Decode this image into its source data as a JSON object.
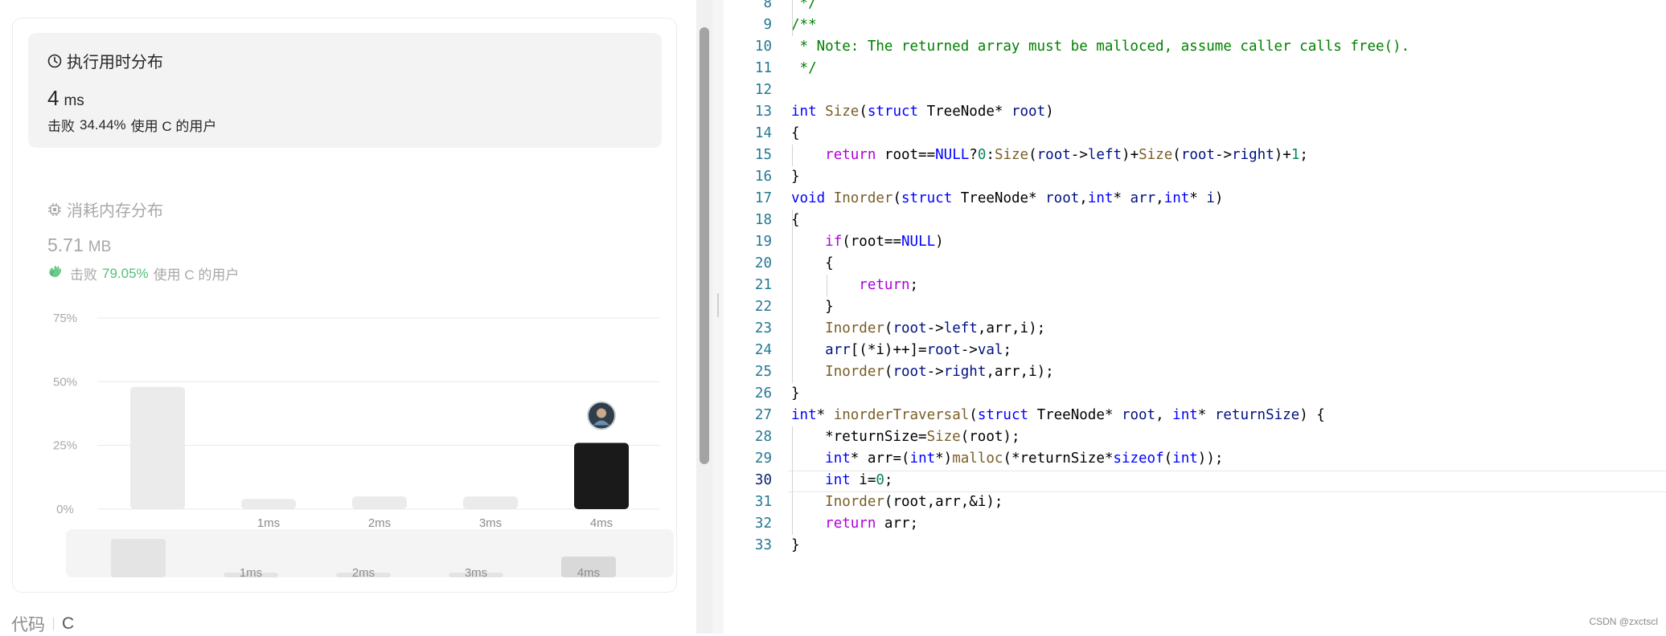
{
  "runtime": {
    "title": "执行用时分布",
    "value": "4",
    "unit": "ms",
    "beat_prefix": "击败",
    "beat_pct": "34.44%",
    "beat_suffix": "使用 C 的用户"
  },
  "memory": {
    "title": "消耗内存分布",
    "value": "5.71",
    "unit": "MB",
    "beat_prefix": "击败",
    "beat_pct": "79.05%",
    "beat_suffix": "使用 C 的用户"
  },
  "chart_data": {
    "type": "bar",
    "categories": [
      "",
      "1ms",
      "2ms",
      "3ms",
      "4ms"
    ],
    "values": [
      48,
      4,
      5,
      5,
      26
    ],
    "highlight_index": 4,
    "y_ticks": [
      "75%",
      "50%",
      "25%",
      "0%"
    ],
    "ylim": [
      0,
      75
    ],
    "grid": true,
    "colors": {
      "bar": "#ebebeb",
      "highlight": "#1a1a1a"
    }
  },
  "footer": {
    "code_label": "代码",
    "lang": "C"
  },
  "editor": {
    "current_line": 30,
    "lines": [
      {
        "n": "8",
        "tokens": [
          [
            "c",
            " */"
          ]
        ]
      },
      {
        "n": "9",
        "tokens": [
          [
            "c",
            "/**"
          ]
        ]
      },
      {
        "n": "10",
        "tokens": [
          [
            "c",
            " * Note: The returned array must be malloced, assume caller calls free()."
          ]
        ]
      },
      {
        "n": "11",
        "tokens": [
          [
            "c",
            " */"
          ]
        ]
      },
      {
        "n": "12",
        "tokens": []
      },
      {
        "n": "13",
        "tokens": [
          [
            "k",
            "int"
          ],
          [
            "p",
            " "
          ],
          [
            "f",
            "Size"
          ],
          [
            "p",
            "("
          ],
          [
            "k",
            "struct"
          ],
          [
            "p",
            " TreeNode* "
          ],
          [
            "v",
            "root"
          ],
          [
            "p",
            ")"
          ]
        ]
      },
      {
        "n": "14",
        "tokens": [
          [
            "p",
            "{"
          ]
        ]
      },
      {
        "n": "15",
        "tokens": [
          [
            "p",
            "    "
          ],
          [
            "ctl",
            "return"
          ],
          [
            "p",
            " root=="
          ],
          [
            "k",
            "NULL"
          ],
          [
            "p",
            "?"
          ],
          [
            "n",
            "0"
          ],
          [
            "p",
            ":"
          ],
          [
            "f",
            "Size"
          ],
          [
            "p",
            "("
          ],
          [
            "v",
            "root"
          ],
          [
            "p",
            "->"
          ],
          [
            "v",
            "left"
          ],
          [
            "p",
            ")+"
          ],
          [
            "f",
            "Size"
          ],
          [
            "p",
            "("
          ],
          [
            "v",
            "root"
          ],
          [
            "p",
            "->"
          ],
          [
            "v",
            "right"
          ],
          [
            "p",
            ")+"
          ],
          [
            "n",
            "1"
          ],
          [
            "p",
            ";"
          ]
        ]
      },
      {
        "n": "16",
        "tokens": [
          [
            "p",
            "}"
          ]
        ]
      },
      {
        "n": "17",
        "tokens": [
          [
            "k",
            "void"
          ],
          [
            "p",
            " "
          ],
          [
            "f",
            "Inorder"
          ],
          [
            "p",
            "("
          ],
          [
            "k",
            "struct"
          ],
          [
            "p",
            " TreeNode* "
          ],
          [
            "v",
            "root"
          ],
          [
            "p",
            ","
          ],
          [
            "k",
            "int"
          ],
          [
            "p",
            "* "
          ],
          [
            "v",
            "arr"
          ],
          [
            "p",
            ","
          ],
          [
            "k",
            "int"
          ],
          [
            "p",
            "* "
          ],
          [
            "v",
            "i"
          ],
          [
            "p",
            ")"
          ]
        ]
      },
      {
        "n": "18",
        "tokens": [
          [
            "p",
            "{"
          ]
        ]
      },
      {
        "n": "19",
        "tokens": [
          [
            "p",
            "    "
          ],
          [
            "ctl",
            "if"
          ],
          [
            "p",
            "(root=="
          ],
          [
            "k",
            "NULL"
          ],
          [
            "p",
            ")"
          ]
        ]
      },
      {
        "n": "20",
        "tokens": [
          [
            "p",
            "    {"
          ]
        ]
      },
      {
        "n": "21",
        "tokens": [
          [
            "p",
            "        "
          ],
          [
            "ctl",
            "return"
          ],
          [
            "p",
            ";"
          ]
        ]
      },
      {
        "n": "22",
        "tokens": [
          [
            "p",
            "    }"
          ]
        ]
      },
      {
        "n": "23",
        "tokens": [
          [
            "p",
            "    "
          ],
          [
            "f",
            "Inorder"
          ],
          [
            "p",
            "("
          ],
          [
            "v",
            "root"
          ],
          [
            "p",
            "->"
          ],
          [
            "v",
            "left"
          ],
          [
            "p",
            ",arr,i);"
          ]
        ]
      },
      {
        "n": "24",
        "tokens": [
          [
            "p",
            "    "
          ],
          [
            "v",
            "arr"
          ],
          [
            "p",
            "[(*i)++]="
          ],
          [
            "v",
            "root"
          ],
          [
            "p",
            "->"
          ],
          [
            "v",
            "val"
          ],
          [
            "p",
            ";"
          ]
        ]
      },
      {
        "n": "25",
        "tokens": [
          [
            "p",
            "    "
          ],
          [
            "f",
            "Inorder"
          ],
          [
            "p",
            "("
          ],
          [
            "v",
            "root"
          ],
          [
            "p",
            "->"
          ],
          [
            "v",
            "right"
          ],
          [
            "p",
            ",arr,i);"
          ]
        ]
      },
      {
        "n": "26",
        "tokens": [
          [
            "p",
            "}"
          ]
        ]
      },
      {
        "n": "27",
        "tokens": [
          [
            "k",
            "int"
          ],
          [
            "p",
            "* "
          ],
          [
            "f",
            "inorderTraversal"
          ],
          [
            "p",
            "("
          ],
          [
            "k",
            "struct"
          ],
          [
            "p",
            " TreeNode* "
          ],
          [
            "v",
            "root"
          ],
          [
            "p",
            ", "
          ],
          [
            "k",
            "int"
          ],
          [
            "p",
            "* "
          ],
          [
            "v",
            "returnSize"
          ],
          [
            "p",
            ") {"
          ]
        ]
      },
      {
        "n": "28",
        "tokens": [
          [
            "p",
            "    *returnSize="
          ],
          [
            "f",
            "Size"
          ],
          [
            "p",
            "(root);"
          ]
        ]
      },
      {
        "n": "29",
        "tokens": [
          [
            "p",
            "    "
          ],
          [
            "k",
            "int"
          ],
          [
            "p",
            "* arr=("
          ],
          [
            "k",
            "int"
          ],
          [
            "p",
            "*)"
          ],
          [
            "f",
            "malloc"
          ],
          [
            "p",
            "(*returnSize*"
          ],
          [
            "k",
            "sizeof"
          ],
          [
            "p",
            "("
          ],
          [
            "k",
            "int"
          ],
          [
            "p",
            "));"
          ]
        ]
      },
      {
        "n": "30",
        "tokens": [
          [
            "p",
            "    "
          ],
          [
            "k",
            "int"
          ],
          [
            "p",
            " i="
          ],
          [
            "n",
            "0"
          ],
          [
            "p",
            ";"
          ]
        ]
      },
      {
        "n": "31",
        "tokens": [
          [
            "p",
            "    "
          ],
          [
            "f",
            "Inorder"
          ],
          [
            "p",
            "(root,arr,&i);"
          ]
        ]
      },
      {
        "n": "32",
        "tokens": [
          [
            "p",
            "    "
          ],
          [
            "ctl",
            "return"
          ],
          [
            "p",
            " arr;"
          ]
        ]
      },
      {
        "n": "33",
        "tokens": [
          [
            "p",
            "}"
          ]
        ]
      }
    ]
  },
  "watermark": "CSDN @zxctscl",
  "icons": {
    "runtime": "clock-icon",
    "memory": "chip-icon",
    "beat": "clap-hands-icon",
    "avatar": "user-avatar"
  }
}
